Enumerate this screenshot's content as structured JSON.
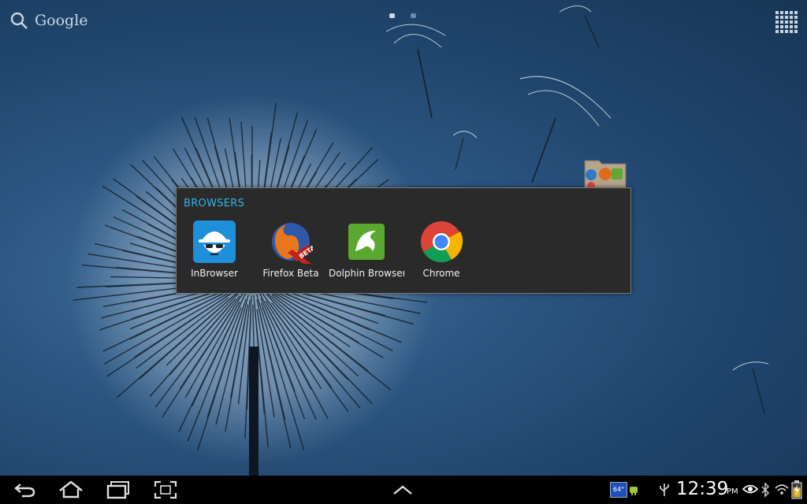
{
  "search": {
    "label": "Google"
  },
  "homescreen": {
    "page_count": 2,
    "active_page": 1
  },
  "folder": {
    "title": "BROWSERS",
    "apps": [
      {
        "label": "InBrowser",
        "icon": "incognito-spy-icon"
      },
      {
        "label": "Firefox Beta",
        "icon": "firefox-beta-icon"
      },
      {
        "label": "Dolphin Browser",
        "icon": "dolphin-icon"
      },
      {
        "label": "Chrome",
        "icon": "chrome-icon"
      }
    ]
  },
  "status": {
    "time": "12:39",
    "ampm": "PM",
    "weather_badge": "64°"
  },
  "colors": {
    "accent": "#33b5e5",
    "navbar": "#000000"
  }
}
